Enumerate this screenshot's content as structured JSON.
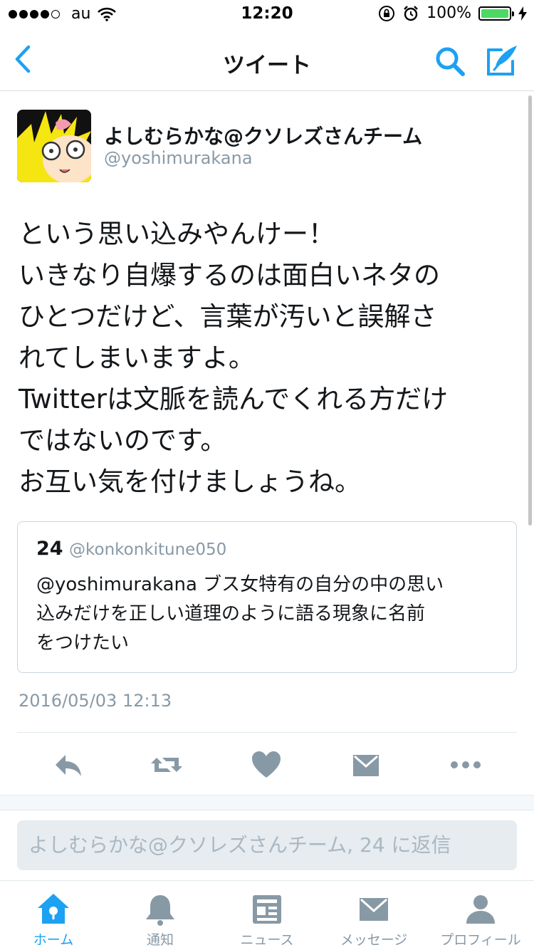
{
  "status_bar": {
    "carrier": "au",
    "time": "12:20",
    "battery": "100%",
    "battery_level": 1.0
  },
  "nav": {
    "title": "ツイート",
    "back_icon": "chevron-left-icon",
    "search_icon": "search-icon",
    "compose_icon": "compose-tweet-icon"
  },
  "tweet": {
    "display_name": "よしむらかな@クソレズさんチーム",
    "handle": "@yoshimurakana",
    "lines": [
      "という思い込みやんけー！",
      "いきなり自爆するのは面白いネタの",
      "ひとつだけど、言葉が汚いと誤解さ",
      "れてしまいますよ。",
      "Twitterは文脈を読んでくれる方だけ",
      "ではないのです。",
      "お互い気を付けましょうね。"
    ],
    "timestamp": "2016/05/03 12:13"
  },
  "quoted_tweet": {
    "name": "24",
    "handle": "@konkonkitune050",
    "lines": [
      "@yoshimurakana ブス女特有の自分の中の思い",
      "込みだけを正しい道理のように語る現象に名前",
      "をつけたい"
    ]
  },
  "actions": [
    "reply-icon",
    "retweet-icon",
    "like-icon",
    "direct-message-icon",
    "more-icon"
  ],
  "reply": {
    "placeholder": "よしむらかな@クソレズさんチーム, 24 に返信"
  },
  "tabs": [
    {
      "label": "ホーム",
      "icon": "home-icon",
      "active": true
    },
    {
      "label": "通知",
      "icon": "bell-icon",
      "active": false
    },
    {
      "label": "ニュース",
      "icon": "news-icon",
      "active": false
    },
    {
      "label": "メッセージ",
      "icon": "envelope-icon",
      "active": false
    },
    {
      "label": "プロフィール",
      "icon": "person-icon",
      "active": false
    }
  ],
  "colors": {
    "accent": "#1da1f2",
    "gray_icon": "#8899a6",
    "battery_green": "#4cd964"
  }
}
